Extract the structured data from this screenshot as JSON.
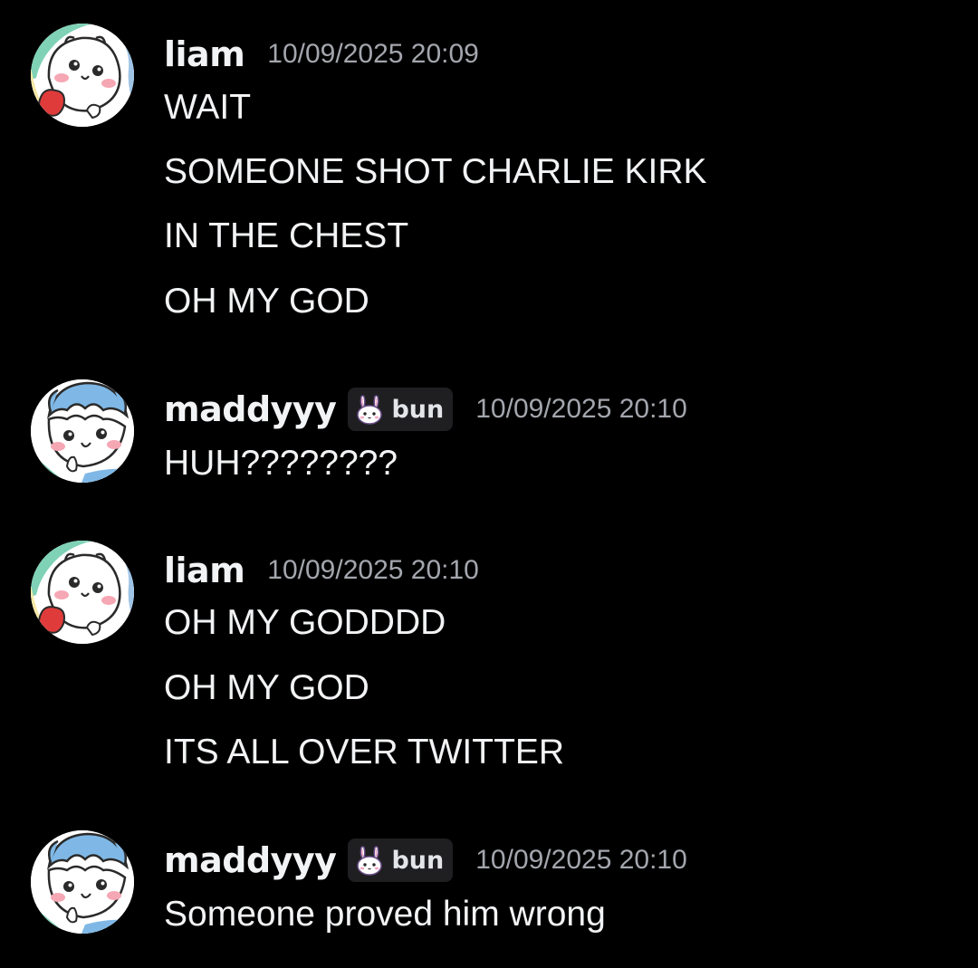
{
  "groups": [
    {
      "username": "liam",
      "timestamp": "10/09/2025 20:09",
      "avatar": "chiikawa-avatar-icon",
      "lines": [
        "WAIT",
        "SOMEONE SHOT CHARLIE KIRK",
        "IN THE CHEST",
        "OH MY GOD"
      ]
    },
    {
      "username": "maddyyy",
      "tag": {
        "icon": "bunny-icon",
        "label": "bun"
      },
      "timestamp": "10/09/2025 20:10",
      "avatar": "hachiware-avatar-icon",
      "lines": [
        "HUH????????"
      ]
    },
    {
      "username": "liam",
      "timestamp": "10/09/2025 20:10",
      "avatar": "chiikawa-avatar-icon",
      "lines": [
        "OH MY GODDDD",
        "OH MY GOD",
        "ITS ALL OVER TWITTER"
      ]
    },
    {
      "username": "maddyyy",
      "tag": {
        "icon": "bunny-icon",
        "label": "bun"
      },
      "timestamp": "10/09/2025 20:10",
      "avatar": "hachiware-avatar-icon",
      "lines": [
        "Someone proved him wrong"
      ]
    }
  ],
  "colors": {
    "background": "#000000",
    "text": "#f2f3f5",
    "timestamp": "#a3a6ad",
    "tag_background": "#1f1f22"
  }
}
